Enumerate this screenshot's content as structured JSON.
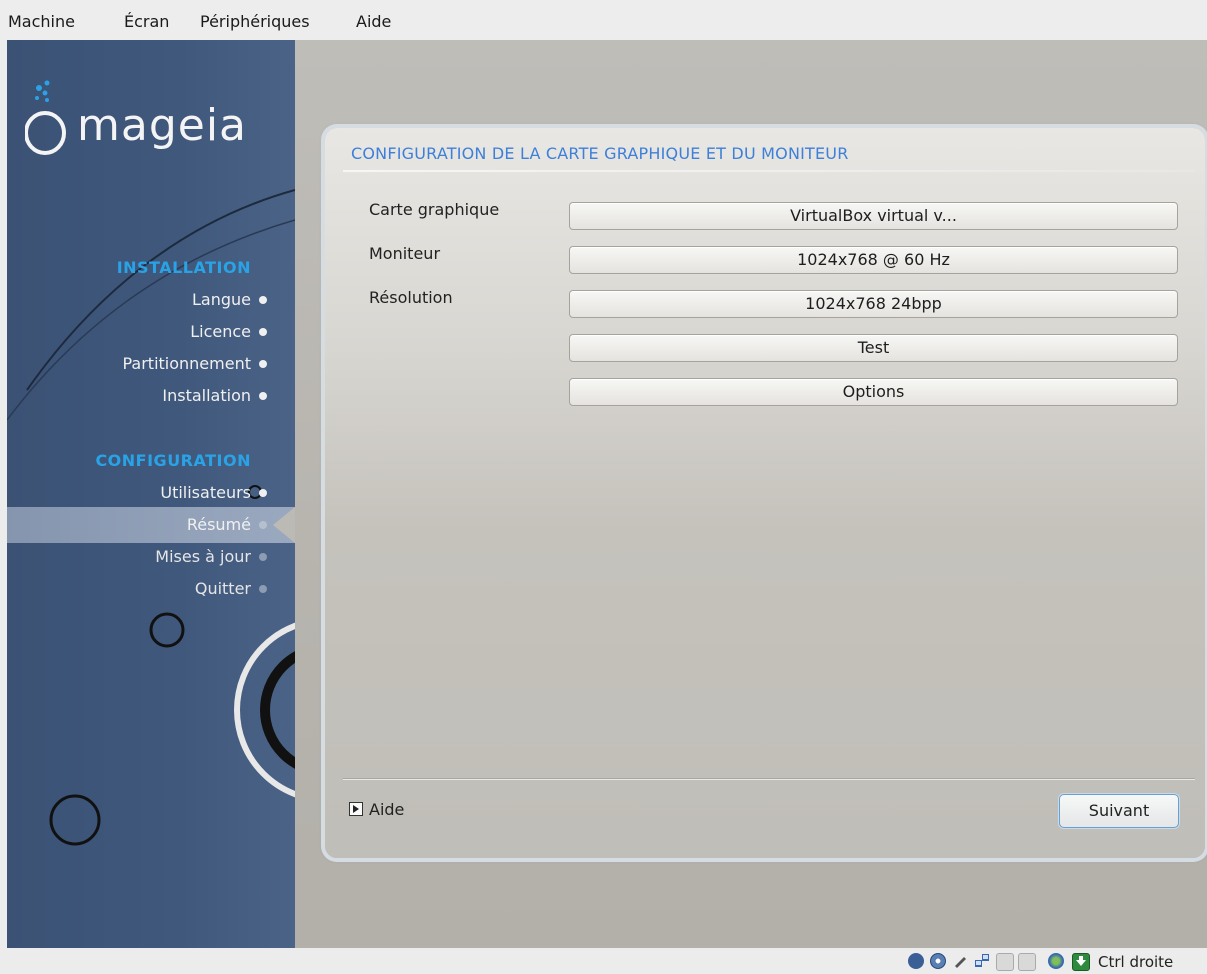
{
  "menubar": {
    "items": [
      {
        "label": "Machine"
      },
      {
        "label": "Écran"
      },
      {
        "label": "Périphériques"
      },
      {
        "label": "Aide"
      }
    ]
  },
  "sidebar": {
    "logo_text": "mageia",
    "sections": [
      {
        "title": "INSTALLATION",
        "steps": [
          {
            "label": "Langue",
            "state": "done"
          },
          {
            "label": "Licence",
            "state": "done"
          },
          {
            "label": "Partitionnement",
            "state": "done"
          },
          {
            "label": "Installation",
            "state": "done"
          }
        ]
      },
      {
        "title": "CONFIGURATION",
        "steps": [
          {
            "label": "Utilisateurs",
            "state": "done"
          },
          {
            "label": "Résumé",
            "state": "active"
          },
          {
            "label": "Mises à jour",
            "state": "pending"
          },
          {
            "label": "Quitter",
            "state": "pending"
          }
        ]
      }
    ]
  },
  "panel": {
    "title": "CONFIGURATION DE LA CARTE GRAPHIQUE ET DU MONITEUR",
    "rows": [
      {
        "label": "Carte graphique",
        "value": "VirtualBox virtual v..."
      },
      {
        "label": "Moniteur",
        "value": "1024x768 @ 60 Hz"
      },
      {
        "label": "Résolution",
        "value": "1024x768 24bpp"
      }
    ],
    "test_label": "Test",
    "options_label": "Options",
    "help_label": "Aide",
    "next_label": "Suivant"
  },
  "statusbar": {
    "host_key_label": "Ctrl droite",
    "icons": [
      "hard-disk-icon",
      "optical-drive-icon",
      "usb-icon",
      "network-icon",
      "shared-folders-icon",
      "display-icon",
      "capture-icon",
      "host-key-arrow-icon"
    ]
  },
  "colors": {
    "sidebar": "#3f587c",
    "section_title": "#2aa3e6",
    "panel_title": "#3d7fd9"
  }
}
